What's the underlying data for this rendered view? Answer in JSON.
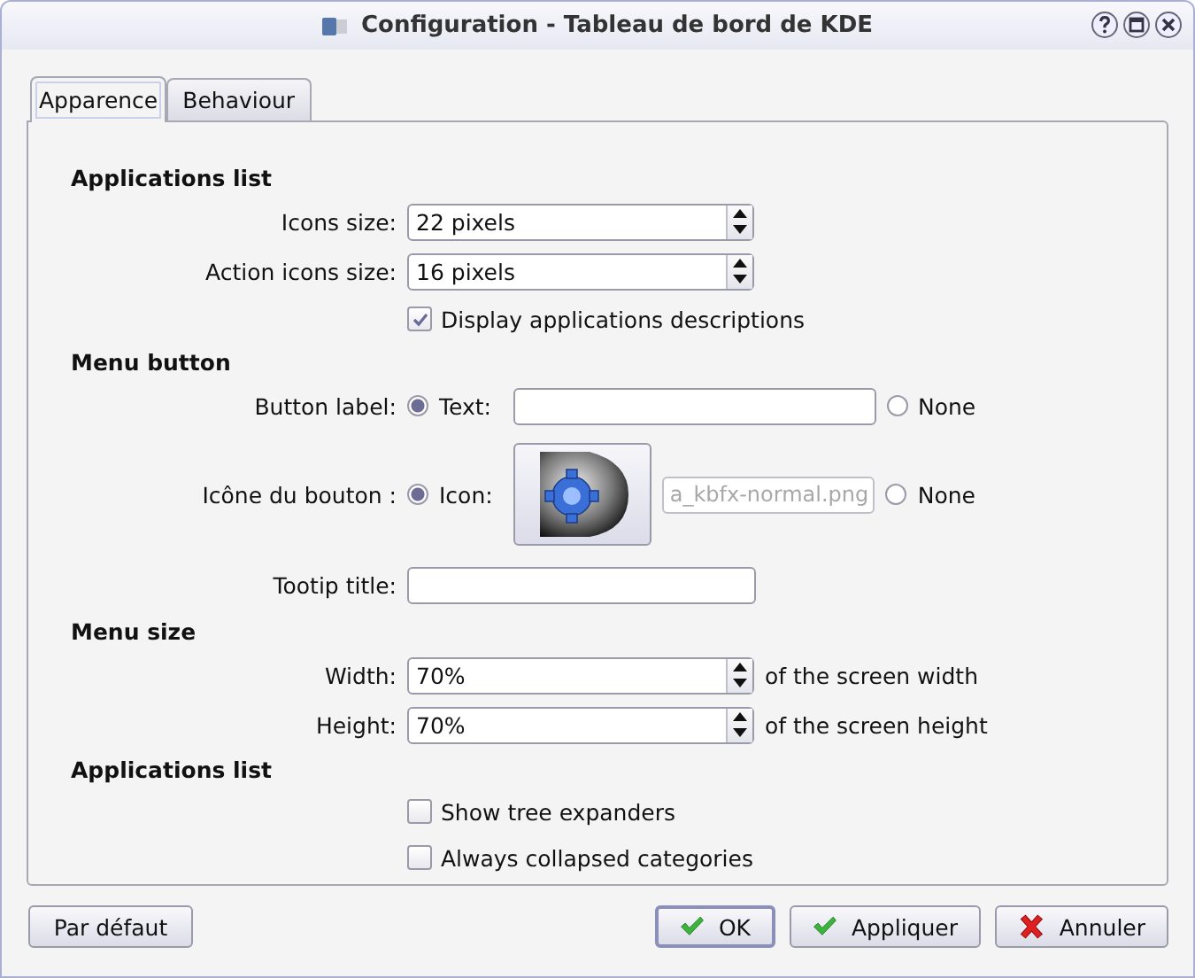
{
  "window": {
    "title": "Configuration - Tableau de bord de KDE"
  },
  "tabs": [
    {
      "label": "Apparence",
      "selected": true
    },
    {
      "label": "Behaviour",
      "selected": false
    }
  ],
  "sections": [
    {
      "title": "Applications list",
      "rows": [
        {
          "kind": "spin",
          "label": "Icons size:",
          "value": "22 pixels"
        },
        {
          "kind": "spin",
          "label": "Action icons size:",
          "value": "16 pixels"
        },
        {
          "kind": "check",
          "label": "Display applications descriptions",
          "checked": true
        }
      ]
    },
    {
      "title": "Menu button",
      "rows": [
        {
          "kind": "radio-text",
          "label": "Button label:",
          "option": "Text:",
          "selected": true,
          "none_label": "None",
          "none_selected": false
        },
        {
          "kind": "radio-icon",
          "label": "Icône du bouton :",
          "option": "Icon:",
          "selected": true,
          "file": "a_kbfx-normal.png",
          "file_disabled": true,
          "none_label": "None",
          "none_selected": false
        },
        {
          "kind": "text",
          "label": "Tootip title:"
        }
      ]
    },
    {
      "title": "Menu size",
      "rows": [
        {
          "kind": "spin",
          "label": "Width:",
          "value": "70%",
          "suffix": "of the screen width"
        },
        {
          "kind": "spin",
          "label": "Height:",
          "value": "70%",
          "suffix": "of the screen height"
        }
      ]
    },
    {
      "title": "Applications list",
      "rows": [
        {
          "kind": "check",
          "label": "Show tree expanders",
          "checked": false
        },
        {
          "kind": "check",
          "label": "Always collapsed categories",
          "checked": false
        }
      ]
    }
  ],
  "buttons": [
    {
      "label": "Par défaut",
      "kind": "plain",
      "focused": false
    },
    {
      "label": "OK",
      "kind": "confirm",
      "focused": true
    },
    {
      "label": "Appliquer",
      "kind": "confirm",
      "focused": false
    },
    {
      "label": "Annuler",
      "kind": "cancel",
      "focused": false
    }
  ]
}
